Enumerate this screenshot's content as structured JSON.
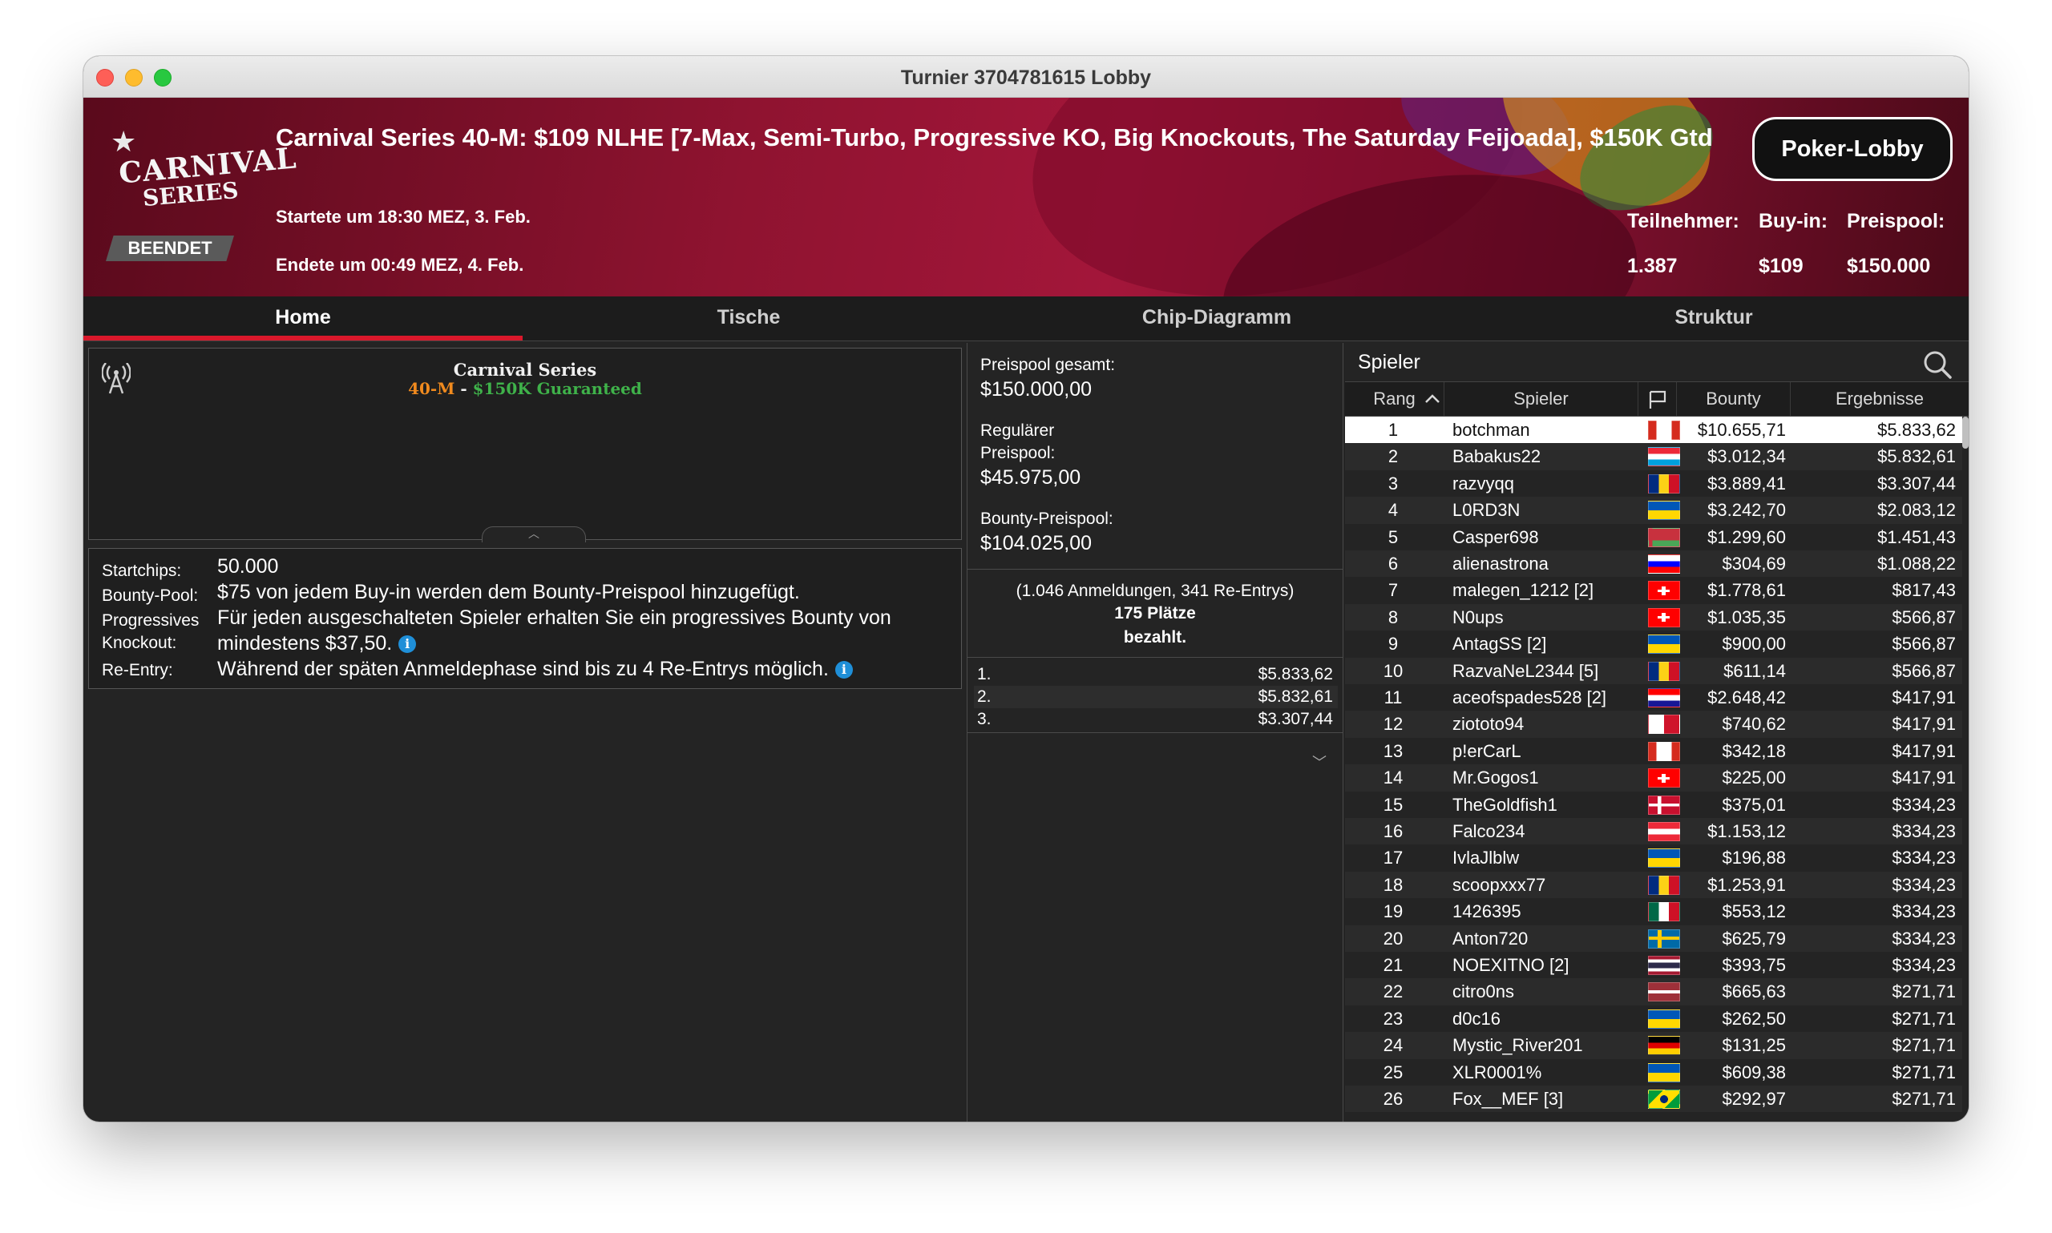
{
  "window": {
    "title": "Turnier 3704781615 Lobby"
  },
  "banner": {
    "logo_line1": "CARNIVAL",
    "logo_line2": "SERIES",
    "status": "BEENDET",
    "title": "Carnival Series 40-M: $109 NLHE [7-Max, Semi-Turbo, Progressive KO, Big Knockouts, The Saturday Feijoada], $150K Gtd",
    "started": "Startete um 18:30 MEZ, 3. Feb.",
    "ended": "Endete um 00:49 MEZ, 4. Feb.",
    "lobby_button": "Poker-Lobby",
    "stats": [
      {
        "label": "Teilnehmer:",
        "value": "1.387"
      },
      {
        "label": "Buy-in:",
        "value": "$109"
      },
      {
        "label": "Preispool:",
        "value": "$150.000"
      }
    ]
  },
  "tabs": [
    "Home",
    "Tische",
    "Chip-Diagramm",
    "Struktur"
  ],
  "info": {
    "title": "Carnival Series",
    "sub_orange": "40-M",
    "sub_dash": " - ",
    "sub_green": "$150K Guaranteed"
  },
  "rules": [
    {
      "label": "Startchips:",
      "value": "50.000"
    },
    {
      "label": "Bounty-Pool:",
      "value": "$75 von jedem Buy-in werden dem Bounty-Preispool hinzugefügt."
    },
    {
      "label": "Progressives",
      "value": "Für jeden ausgeschalteten Spieler erhalten Sie ein progressives Bounty von"
    },
    {
      "label": "Knockout:",
      "value": "mindestens $37,50."
    },
    {
      "label": "Re-Entry:",
      "value": "Während der späten Anmeldephase sind bis zu 4 Re-Entrys möglich."
    }
  ],
  "prizepool": {
    "total_label": "Preispool gesamt:",
    "total_value": "$150.000,00",
    "regular_label_1": "Regulärer",
    "regular_label_2": "Preispool:",
    "regular_value": "$45.975,00",
    "bounty_label": "Bounty-Preispool:",
    "bounty_value": "$104.025,00",
    "entries": "(1.046 Anmeldungen, 341 Re-Entrys)",
    "paid_places": "175 Plätze",
    "paid_label": "bezahlt.",
    "payouts": [
      {
        "place": "1.",
        "amount": "$5.833,62"
      },
      {
        "place": "2.",
        "amount": "$5.832,61"
      },
      {
        "place": "3.",
        "amount": "$3.307,44"
      }
    ]
  },
  "players": {
    "title": "Spieler",
    "columns": {
      "rank": "Rang",
      "player": "Spieler",
      "bounty": "Bounty",
      "result": "Ergebnisse"
    },
    "rows": [
      {
        "rank": "1",
        "name": "botchman",
        "flag": "ca",
        "bounty": "$10.655,71",
        "result": "$5.833,62"
      },
      {
        "rank": "2",
        "name": "Babakus22",
        "flag": "lu",
        "bounty": "$3.012,34",
        "result": "$5.832,61"
      },
      {
        "rank": "3",
        "name": "razvyqq",
        "flag": "ro",
        "bounty": "$3.889,41",
        "result": "$3.307,44"
      },
      {
        "rank": "4",
        "name": "L0RD3N",
        "flag": "ua",
        "bounty": "$3.242,70",
        "result": "$2.083,12"
      },
      {
        "rank": "5",
        "name": "Casper698",
        "flag": "by",
        "bounty": "$1.299,60",
        "result": "$1.451,43"
      },
      {
        "rank": "6",
        "name": "alienastrona",
        "flag": "si",
        "bounty": "$304,69",
        "result": "$1.088,22"
      },
      {
        "rank": "7",
        "name": "malegen_1212 [2]",
        "flag": "ch",
        "bounty": "$1.778,61",
        "result": "$817,43"
      },
      {
        "rank": "8",
        "name": "N0ups",
        "flag": "ch",
        "bounty": "$1.035,35",
        "result": "$566,87"
      },
      {
        "rank": "9",
        "name": "AntagSS [2]",
        "flag": "ua",
        "bounty": "$900,00",
        "result": "$566,87"
      },
      {
        "rank": "10",
        "name": "RazvaNeL2344 [5]",
        "flag": "ro",
        "bounty": "$611,14",
        "result": "$566,87"
      },
      {
        "rank": "11",
        "name": "aceofspades528 [2]",
        "flag": "hr",
        "bounty": "$2.648,42",
        "result": "$417,91"
      },
      {
        "rank": "12",
        "name": "ziototo94",
        "flag": "mt",
        "bounty": "$740,62",
        "result": "$417,91"
      },
      {
        "rank": "13",
        "name": "p!erCarL",
        "flag": "ca",
        "bounty": "$342,18",
        "result": "$417,91"
      },
      {
        "rank": "14",
        "name": "Mr.Gogos1",
        "flag": "ch",
        "bounty": "$225,00",
        "result": "$417,91"
      },
      {
        "rank": "15",
        "name": "TheGoldfish1",
        "flag": "dk",
        "bounty": "$375,01",
        "result": "$334,23"
      },
      {
        "rank": "16",
        "name": "Falco234",
        "flag": "at",
        "bounty": "$1.153,12",
        "result": "$334,23"
      },
      {
        "rank": "17",
        "name": "IvlaJlblw",
        "flag": "ua",
        "bounty": "$196,88",
        "result": "$334,23"
      },
      {
        "rank": "18",
        "name": "scoopxxx77",
        "flag": "ro",
        "bounty": "$1.253,91",
        "result": "$334,23"
      },
      {
        "rank": "19",
        "name": "1426395",
        "flag": "mx",
        "bounty": "$553,12",
        "result": "$334,23"
      },
      {
        "rank": "20",
        "name": "Anton720",
        "flag": "se",
        "bounty": "$625,79",
        "result": "$334,23"
      },
      {
        "rank": "21",
        "name": "NOEXITNO [2]",
        "flag": "th",
        "bounty": "$393,75",
        "result": "$334,23"
      },
      {
        "rank": "22",
        "name": "citro0ns",
        "flag": "lv",
        "bounty": "$665,63",
        "result": "$271,71"
      },
      {
        "rank": "23",
        "name": "d0c16",
        "flag": "ua",
        "bounty": "$262,50",
        "result": "$271,71"
      },
      {
        "rank": "24",
        "name": "Mystic_River201",
        "flag": "de",
        "bounty": "$131,25",
        "result": "$271,71"
      },
      {
        "rank": "25",
        "name": "XLR0001%",
        "flag": "ua",
        "bounty": "$609,38",
        "result": "$271,71"
      },
      {
        "rank": "26",
        "name": "Fox__MEF [3]",
        "flag": "br",
        "bounty": "$292,97",
        "result": "$271,71"
      }
    ]
  }
}
